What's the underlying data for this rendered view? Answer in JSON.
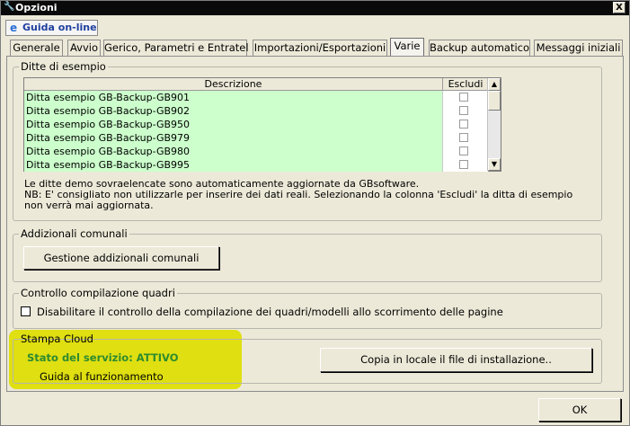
{
  "window": {
    "title": "Opzioni",
    "close_glyph": "X",
    "icon": "wrench-icon"
  },
  "help": {
    "label": "Guida on-line",
    "icon_glyph": "e"
  },
  "tabs": [
    {
      "label": "Generale",
      "active": false
    },
    {
      "label": "Avvio",
      "active": false
    },
    {
      "label": "Gerico, Parametri e Entratel",
      "active": false
    },
    {
      "label": "Importazioni/Esportazioni",
      "active": false
    },
    {
      "label": "Varie",
      "active": true
    },
    {
      "label": "Backup automatico",
      "active": false
    },
    {
      "label": "Messaggi iniziali",
      "active": false
    }
  ],
  "ditte": {
    "group_label": "Ditte di esempio",
    "columns": {
      "descrizione": "Descrizione",
      "escludi": "Escludi"
    },
    "rows": [
      {
        "descrizione": "Ditta esempio GB-Backup-GB901",
        "escludi": false
      },
      {
        "descrizione": "Ditta esempio GB-Backup-GB902",
        "escludi": false
      },
      {
        "descrizione": "Ditta esempio GB-Backup-GB950",
        "escludi": false
      },
      {
        "descrizione": "Ditta esempio GB-Backup-GB979",
        "escludi": false
      },
      {
        "descrizione": "Ditta esempio GB-Backup-GB980",
        "escludi": false
      },
      {
        "descrizione": "Ditta esempio GB-Backup-GB995",
        "escludi": false
      }
    ],
    "note_line1": "Le ditte demo sovraelencate sono automaticamente aggiornate da GBsoftware.",
    "note_line2": "NB: E' consigliato non utilizzarle per inserire dei dati reali. Selezionando la colonna 'Escludi' la ditta di esempio",
    "note_line3": "non verrà mai aggiornata."
  },
  "addizionali": {
    "group_label": "Addizionali comunali",
    "button_label": "Gestione addizionali comunali"
  },
  "controllo": {
    "group_label": "Controllo compilazione quadri",
    "checkbox_label": "Disabilitare il controllo della compilazione dei quadri/modelli allo scorrimento delle pagine",
    "checked": false
  },
  "cloud": {
    "group_label": "Stampa Cloud",
    "status_text": "Stato del servizio: ATTIVO",
    "guide_label": "Guida al funzionamento",
    "copy_button_label": "Copia in locale il file di installazione..",
    "highlight_color": "#dddd00",
    "status_color": "#2e8b2e"
  },
  "footer": {
    "ok_label": "OK"
  }
}
